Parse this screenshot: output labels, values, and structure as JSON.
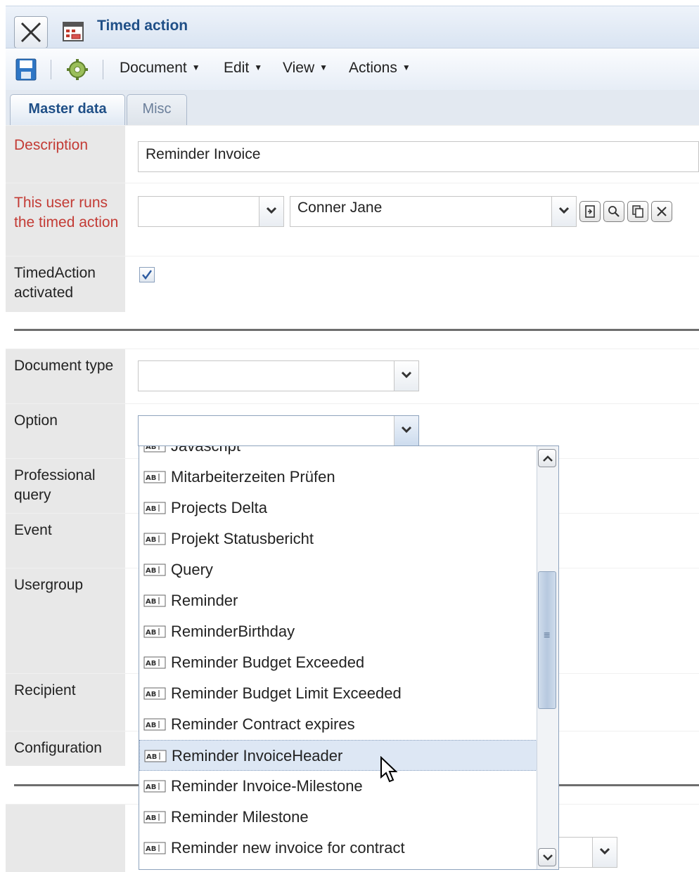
{
  "window": {
    "title": "Timed action"
  },
  "toolbar": {
    "menus": [
      {
        "label": "Document"
      },
      {
        "label": "Edit"
      },
      {
        "label": "View"
      },
      {
        "label": "Actions"
      }
    ]
  },
  "tabs": [
    {
      "label": "Master data",
      "active": true
    },
    {
      "label": "Misc",
      "active": false
    }
  ],
  "form": {
    "description": {
      "label": "Description",
      "value": "Reminder Invoice"
    },
    "runs_user": {
      "label": "This user runs the timed action",
      "first_value": "",
      "second_value": "Conner Jane"
    },
    "activated": {
      "label": "TimedAction activated",
      "checked": true
    },
    "document_type": {
      "label": "Document type",
      "value": ""
    },
    "option": {
      "label": "Option",
      "value": ""
    },
    "professional_query": {
      "label": "Professional query"
    },
    "event": {
      "label": "Event"
    },
    "usergroup": {
      "label": "Usergroup"
    },
    "recipient": {
      "label": "Recipient"
    },
    "configuration": {
      "label": "Configuration"
    }
  },
  "dropdown": {
    "items": [
      {
        "label": "Javascript"
      },
      {
        "label": "Mitarbeiterzeiten Prüfen"
      },
      {
        "label": "Projects Delta"
      },
      {
        "label": "Projekt Statusbericht"
      },
      {
        "label": "Query"
      },
      {
        "label": "Reminder"
      },
      {
        "label": "ReminderBirthday"
      },
      {
        "label": "Reminder Budget Exceeded"
      },
      {
        "label": "Reminder Budget Limit Exceeded"
      },
      {
        "label": "Reminder Contract expires"
      },
      {
        "label": "Reminder InvoiceHeader",
        "highlighted": true
      },
      {
        "label": "Reminder Invoice-Milestone"
      },
      {
        "label": "Reminder Milestone"
      },
      {
        "label": "Reminder new invoice for contract"
      }
    ],
    "scroll_position_fraction": 0.45
  },
  "icons": {
    "close": "close-icon",
    "window": "calendar-window-icon",
    "save": "save-icon",
    "settings": "gear-icon",
    "list_item": "text-type-icon"
  },
  "colors": {
    "required_label": "#c33b35",
    "title": "#1f4f87",
    "highlight": "#dde7f4"
  }
}
